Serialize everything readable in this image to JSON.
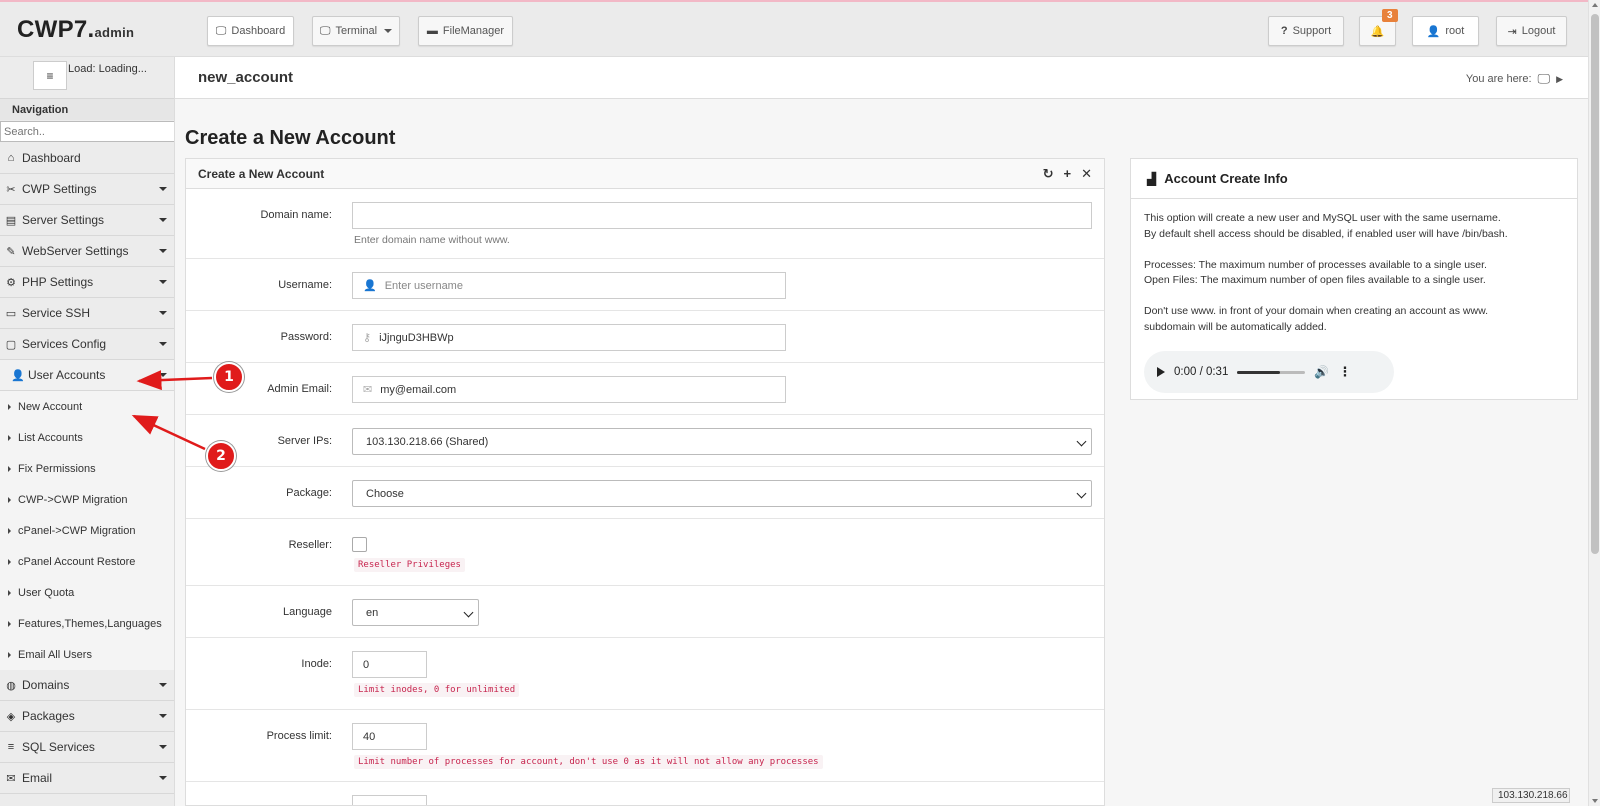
{
  "brand": {
    "name": "CWP7.",
    "suffix": "admin"
  },
  "topbar": {
    "dashboard": "Dashboard",
    "terminal": "Terminal",
    "filemanager": "FileManager",
    "support": "Support",
    "notifications_count": "3",
    "user": "root",
    "logout": "Logout"
  },
  "sidebar": {
    "load": "Load: Loading...",
    "nav_header": "Navigation",
    "search_placeholder": "Search..",
    "items": [
      {
        "label": "Dashboard",
        "icon": "home-icon"
      },
      {
        "label": "CWP Settings",
        "icon": "tools-icon"
      },
      {
        "label": "Server Settings",
        "icon": "server-icon"
      },
      {
        "label": "WebServer Settings",
        "icon": "feather-icon"
      },
      {
        "label": "PHP Settings",
        "icon": "gear-icon"
      },
      {
        "label": "Service SSH",
        "icon": "monitor-icon"
      },
      {
        "label": "Services Config",
        "icon": "edit-icon"
      },
      {
        "label": "User Accounts",
        "icon": "user-icon"
      }
    ],
    "subitems": [
      "New Account",
      "List Accounts",
      "Fix Permissions",
      "CWP->CWP Migration",
      "cPanel->CWP Migration",
      "cPanel Account Restore",
      "User Quota",
      "Features,Themes,Languages",
      "Email All Users"
    ],
    "items_after": [
      {
        "label": "Domains",
        "icon": "globe-icon"
      },
      {
        "label": "Packages",
        "icon": "cubes-icon"
      },
      {
        "label": "SQL Services",
        "icon": "database-icon"
      },
      {
        "label": "Email",
        "icon": "envelope-icon"
      }
    ]
  },
  "titlebar": {
    "page": "new_account",
    "you_are_here": "You are here:"
  },
  "main": {
    "heading": "Create a New Account",
    "panel_title": "Create a New Account",
    "form": {
      "domain_label": "Domain name:",
      "domain_help": "Enter domain name without www.",
      "username_label": "Username:",
      "username_placeholder": "Enter username",
      "password_label": "Password:",
      "password_value": "iJjnguD3HBWp",
      "email_label": "Admin Email:",
      "email_value": "my@email.com",
      "ips_label": "Server IPs:",
      "ips_value": "103.130.218.66 (Shared)",
      "package_label": "Package:",
      "package_value": "Choose",
      "reseller_label": "Reseller:",
      "reseller_help": "Reseller Privileges",
      "language_label": "Language",
      "language_value": "en",
      "inode_label": "Inode:",
      "inode_value": "0",
      "inode_help": "Limit inodes, 0 for unlimited",
      "process_label": "Process limit:",
      "process_value": "40",
      "process_help": "Limit number of processes for account, don't use 0 as it will not allow any processes"
    }
  },
  "info": {
    "title": "Account Create Info",
    "p1a": "This option will create a new user and MySQL user with the same username.",
    "p1b": "By default shell access should be disabled, if enabled user will have /bin/bash.",
    "p2a": "Processes: The maximum number of processes available to a single user.",
    "p2b": "Open Files: The maximum number of open files available to a single user.",
    "p3a": "Don't use www. in front of your domain when creating an account as www.",
    "p3b": "subdomain will be automatically added.",
    "audio_time": "0:00 / 0:31",
    "audio_progress": 0.62
  },
  "footer_ip": "103.130.218.66",
  "annotations": [
    "1",
    "2"
  ],
  "colors": {
    "annotation": "#e01b1b",
    "badge": "#e8813b",
    "code_text": "#c7254e"
  }
}
